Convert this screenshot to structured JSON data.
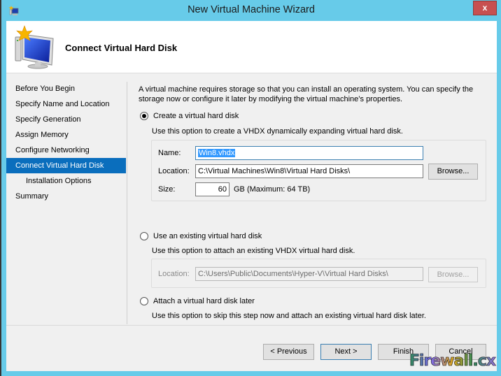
{
  "window": {
    "title": "New Virtual Machine Wizard",
    "close_label": "x"
  },
  "header": {
    "title": "Connect Virtual Hard Disk"
  },
  "sidebar": {
    "items": [
      {
        "label": "Before You Begin",
        "active": false,
        "sub": false
      },
      {
        "label": "Specify Name and Location",
        "active": false,
        "sub": false
      },
      {
        "label": "Specify Generation",
        "active": false,
        "sub": false
      },
      {
        "label": "Assign Memory",
        "active": false,
        "sub": false
      },
      {
        "label": "Configure Networking",
        "active": false,
        "sub": false
      },
      {
        "label": "Connect Virtual Hard Disk",
        "active": true,
        "sub": false
      },
      {
        "label": "Installation Options",
        "active": false,
        "sub": true
      },
      {
        "label": "Summary",
        "active": false,
        "sub": false
      }
    ]
  },
  "content": {
    "intro": "A virtual machine requires storage so that you can install an operating system. You can specify the storage now or configure it later by modifying the virtual machine’s properties.",
    "option_create": {
      "label": "Create a virtual hard disk",
      "checked": true,
      "description": "Use this option to create a VHDX dynamically expanding virtual hard disk.",
      "name_label": "Name:",
      "name_value": "Win8.vhdx",
      "location_label": "Location:",
      "location_value": "C:\\Virtual Machines\\Win8\\Virtual Hard Disks\\",
      "browse_label": "Browse...",
      "size_label": "Size:",
      "size_value": "60",
      "size_unit": "GB (Maximum: 64 TB)"
    },
    "option_existing": {
      "label": "Use an existing virtual hard disk",
      "checked": false,
      "description": "Use this option to attach an existing VHDX virtual hard disk.",
      "location_label": "Location:",
      "location_value": "C:\\Users\\Public\\Documents\\Hyper-V\\Virtual Hard Disks\\",
      "browse_label": "Browse..."
    },
    "option_later": {
      "label": "Attach a virtual hard disk later",
      "checked": false,
      "description": "Use this option to skip this step now and attach an existing virtual hard disk later."
    }
  },
  "footer": {
    "previous_label": "< Previous",
    "next_label": "Next >",
    "finish_label": "Finish",
    "cancel_label": "Cancel"
  },
  "watermark": "Firewall.cx",
  "colors": {
    "titlebar": "#67cbe9",
    "selection": "#0a6ebd",
    "close": "#c75050"
  }
}
